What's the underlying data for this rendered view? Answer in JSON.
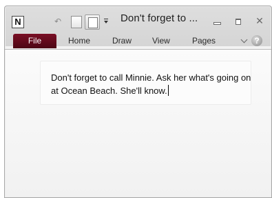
{
  "window": {
    "title": "Don't forget to ...",
    "app_icon_letter": "N"
  },
  "ribbon": {
    "tabs": [
      {
        "label": "File"
      },
      {
        "label": "Home"
      },
      {
        "label": "Draw"
      },
      {
        "label": "View"
      },
      {
        "label": "Pages"
      }
    ],
    "help_label": "?"
  },
  "note": {
    "text": "Don't forget to call Minnie. Ask her what's going on at Ocean Beach. She'll know."
  },
  "icons": {
    "undo": "undo-icon",
    "page": "page-icon",
    "dock": "dock-to-desktop-icon",
    "customize": "customize-quick-access-icon",
    "minimize": "minimize-icon",
    "maximize": "maximize-icon",
    "close": "close-icon",
    "expand": "expand-ribbon-icon",
    "help": "help-icon"
  },
  "colors": {
    "file_tab": "#6a0c1f",
    "chrome": "#d9d9d9",
    "content_bg": "#fbfbfb"
  }
}
